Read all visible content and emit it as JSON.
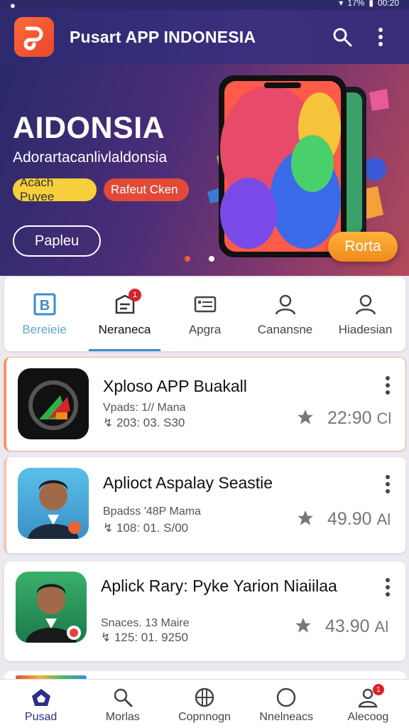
{
  "status_bar": {
    "time": "00:20",
    "battery": "17%"
  },
  "header": {
    "title": "Pusart APP INDONESIA"
  },
  "banner": {
    "title": "AIDONSIA",
    "subtitle": "Adorartacanlivlaldonsia",
    "tag_yellow": "Acách Puyee",
    "tag_red": "Rafeut Cken",
    "outline_button": "Papleu",
    "cta_button": "Rorta",
    "carousel_pages": 2,
    "carousel_active": 2
  },
  "categories": [
    {
      "label": "Bereieie",
      "icon": "b-icon"
    },
    {
      "label": "Neraneca",
      "icon": "calendar-news-icon",
      "badge": "1"
    },
    {
      "label": "Apgra",
      "icon": "card-icon"
    },
    {
      "label": "Canansne",
      "icon": "user-icon"
    },
    {
      "label": "Hiadesian",
      "icon": "user-icon"
    }
  ],
  "apps": [
    {
      "name": "Xploso APP Buakall",
      "meta": "Vpads: 1// Mana",
      "stat": "203: 03. S30",
      "price": "22:90",
      "suffix": "Cl"
    },
    {
      "name": "Aplioct Aspalay Seastie",
      "meta": "Bpadss '48P Mama",
      "stat": "108: 01. S/00",
      "price": "49.90",
      "suffix": "Al"
    },
    {
      "name": "Aplick Rary: Pyke Yarion Niaiilaa",
      "meta": "Snaces. 13 Maire",
      "stat": "125: 01. 9250",
      "price": "43.90",
      "suffix": "Al"
    }
  ],
  "bottom_nav": [
    {
      "label": "Pusad",
      "icon": "home-icon"
    },
    {
      "label": "Morlas",
      "icon": "search-icon"
    },
    {
      "label": "Copnnogn",
      "icon": "grid-circle-icon"
    },
    {
      "label": "Nnelneacs",
      "icon": "circle-icon"
    },
    {
      "label": "Alecoog",
      "icon": "profile-icon",
      "badge": "1"
    }
  ],
  "colors": {
    "header": "#2d2a6e",
    "accent": "#3b8ec8",
    "cta": "#f08a1a",
    "badge": "#d8232a"
  }
}
